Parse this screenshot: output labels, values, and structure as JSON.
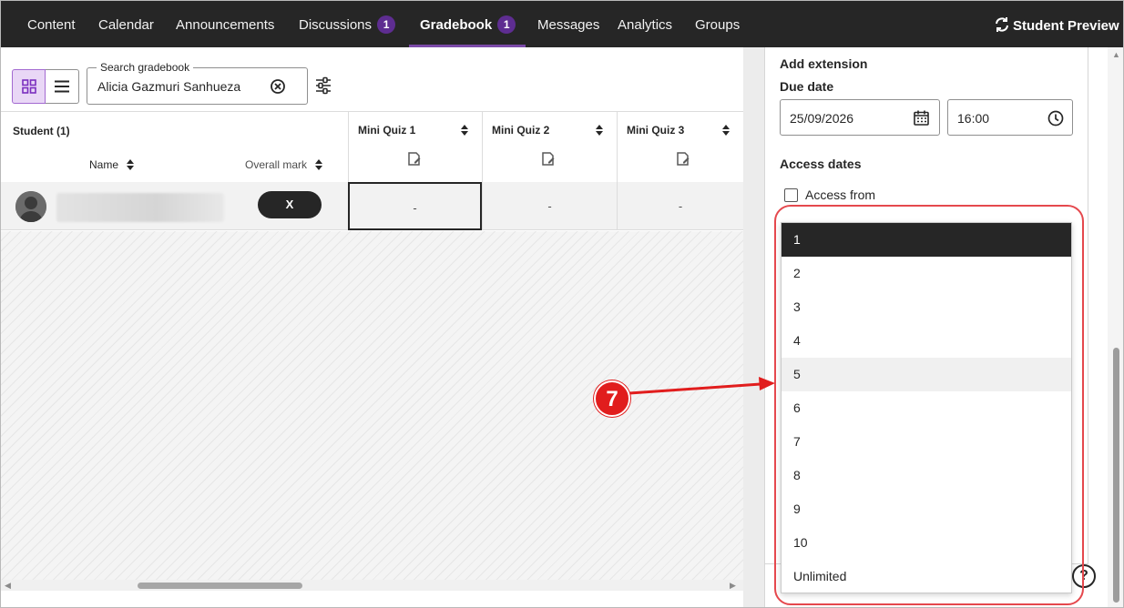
{
  "nav": {
    "tabs": [
      {
        "label": "Content"
      },
      {
        "label": "Calendar"
      },
      {
        "label": "Announcements"
      },
      {
        "label": "Discussions",
        "badge": "1"
      },
      {
        "label": "Gradebook",
        "badge": "1",
        "active": true
      },
      {
        "label": "Messages"
      },
      {
        "label": "Analytics"
      },
      {
        "label": "Groups"
      }
    ],
    "student_preview": "Student Preview"
  },
  "gradebook": {
    "search_legend": "Search gradebook",
    "search_value": "Alicia Gazmuri Sanhueza",
    "student_header": "Student (1)",
    "name_header": "Name",
    "overall_header": "Overall mark",
    "columns": [
      "Mini Quiz 1",
      "Mini Quiz 2",
      "Mini Quiz 3"
    ],
    "row": {
      "overall_mark": "X",
      "cells": [
        "-",
        "-",
        "-"
      ]
    }
  },
  "panel": {
    "add_extension": "Add extension",
    "due_date_label": "Due date",
    "due_date": "25/09/2026",
    "due_time": "16:00",
    "access_dates": "Access dates",
    "access_from": "Access from"
  },
  "dropdown": {
    "options": [
      "1",
      "2",
      "3",
      "4",
      "5",
      "6",
      "7",
      "8",
      "9",
      "10",
      "Unlimited"
    ],
    "selected": "1",
    "hovered": "5"
  },
  "callout": "7",
  "colors": {
    "nav_bg": "#262626",
    "badge": "#5e2d91",
    "accent": "#7b4aa8",
    "callout": "#e11d1d",
    "highlight": "#e5484d"
  },
  "help_icon": "?"
}
